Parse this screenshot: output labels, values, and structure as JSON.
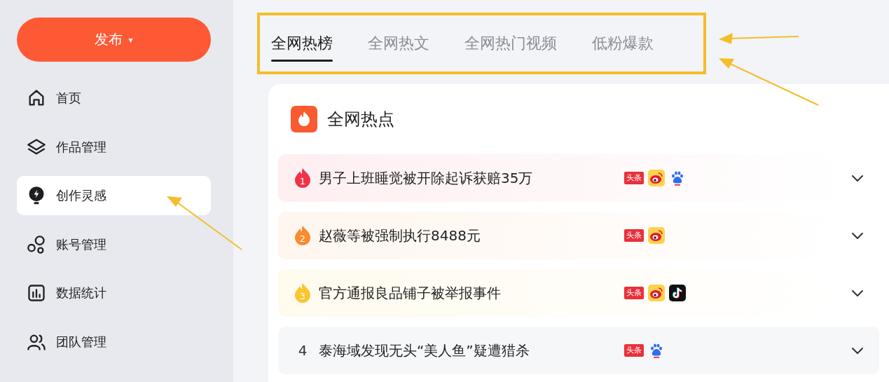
{
  "sidebar": {
    "publish_button": {
      "label": "发布",
      "caret": "▾"
    },
    "items": [
      {
        "label": "首页",
        "kind": "home",
        "selected": false
      },
      {
        "label": "作品管理",
        "kind": "layers",
        "selected": false
      },
      {
        "label": "创作灵感",
        "kind": "bulb",
        "selected": true
      },
      {
        "label": "账号管理",
        "kind": "circles",
        "selected": false
      },
      {
        "label": "数据统计",
        "kind": "chart",
        "selected": false
      },
      {
        "label": "团队管理",
        "kind": "team",
        "selected": false
      }
    ]
  },
  "tabs": [
    {
      "label": "全网热榜",
      "selected": true
    },
    {
      "label": "全网热文",
      "selected": false
    },
    {
      "label": "全网热门视频",
      "selected": false
    },
    {
      "label": "低粉爆款",
      "selected": false
    }
  ],
  "card": {
    "title": "全网热点",
    "rows": [
      {
        "rank": "1",
        "kind": "flame",
        "color": "#f0334a",
        "title": "男子上班睡觉被开除起诉获赔35万",
        "sources": [
          {
            "kind": "toutiao",
            "label": "头条"
          },
          {
            "kind": "weibo"
          },
          {
            "kind": "baidu"
          }
        ]
      },
      {
        "rank": "2",
        "kind": "flame",
        "color": "#fa8a2e",
        "title": "赵薇等被强制执行8488元",
        "sources": [
          {
            "kind": "toutiao",
            "label": "头条"
          },
          {
            "kind": "weibo"
          }
        ]
      },
      {
        "rank": "3",
        "kind": "flame",
        "color": "#fbc52d",
        "title": "官方通报良品铺子被举报事件",
        "sources": [
          {
            "kind": "toutiao",
            "label": "头条"
          },
          {
            "kind": "weibo"
          },
          {
            "kind": "douyin"
          }
        ]
      },
      {
        "rank": "4",
        "kind": "plain",
        "title": "泰海域发现无头“美人鱼”疑遭猎杀",
        "sources": [
          {
            "kind": "toutiao",
            "label": "头条"
          },
          {
            "kind": "baidu"
          }
        ]
      }
    ]
  }
}
